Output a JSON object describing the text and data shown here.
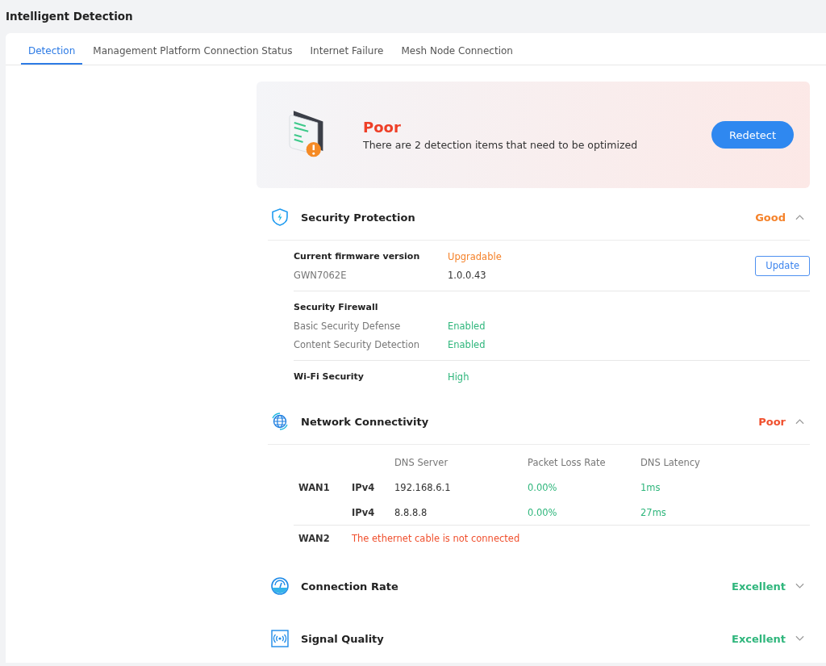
{
  "page_title": "Intelligent Detection",
  "tabs": [
    {
      "label": "Detection",
      "selected": true
    },
    {
      "label": "Management Platform Connection Status",
      "selected": false
    },
    {
      "label": "Internet Failure",
      "selected": false
    },
    {
      "label": "Mesh Node Connection",
      "selected": false
    }
  ],
  "summary": {
    "status": "Poor",
    "message": "There are 2 detection items that need to be optimized",
    "button": "Redetect"
  },
  "sections": [
    {
      "kind": "security",
      "title": "Security Protection",
      "rating": "Good",
      "color": "#f5822a",
      "expanded": true,
      "groups": [
        {
          "rows": [
            {
              "kind": "heading",
              "label": "Current firmware version",
              "value": "Upgradable",
              "color": "#f5822a"
            },
            {
              "kind": "plain",
              "label": "GWN7062E",
              "value": "1.0.0.43",
              "color": "#333333"
            }
          ],
          "button": "Update"
        },
        {
          "rows": [
            {
              "kind": "heading",
              "label": "Security Firewall"
            },
            {
              "kind": "plain",
              "label": "Basic Security Defense",
              "value": "Enabled",
              "color": "#2fb67c"
            },
            {
              "kind": "plain",
              "label": "Content Security Detection",
              "value": "Enabled",
              "color": "#2fb67c"
            }
          ]
        },
        {
          "rows": [
            {
              "kind": "heading",
              "label": "Wi-Fi Security",
              "value": "High",
              "color": "#2fb67c"
            }
          ]
        }
      ]
    },
    {
      "kind": "network",
      "title": "Network Connectivity",
      "rating": "Poor",
      "color": "#f0502e",
      "expanded": true,
      "columns": [
        "DNS Server",
        "Packet Loss Rate",
        "DNS Latency"
      ],
      "wans": [
        {
          "name": "WAN1",
          "rows": [
            {
              "protocol": "IPv4",
              "server": "192.168.6.1",
              "loss": "0.00%",
              "latency": "1ms"
            },
            {
              "protocol": "IPv4",
              "server": "8.8.8.8",
              "loss": "0.00%",
              "latency": "27ms"
            }
          ]
        },
        {
          "name": "WAN2",
          "error": "The ethernet cable is not connected"
        }
      ]
    },
    {
      "kind": "rate",
      "title": "Connection Rate",
      "rating": "Excellent",
      "color": "#2fb67c",
      "expanded": false
    },
    {
      "kind": "signal",
      "title": "Signal Quality",
      "rating": "Excellent",
      "color": "#2fb67c",
      "expanded": false
    }
  ]
}
